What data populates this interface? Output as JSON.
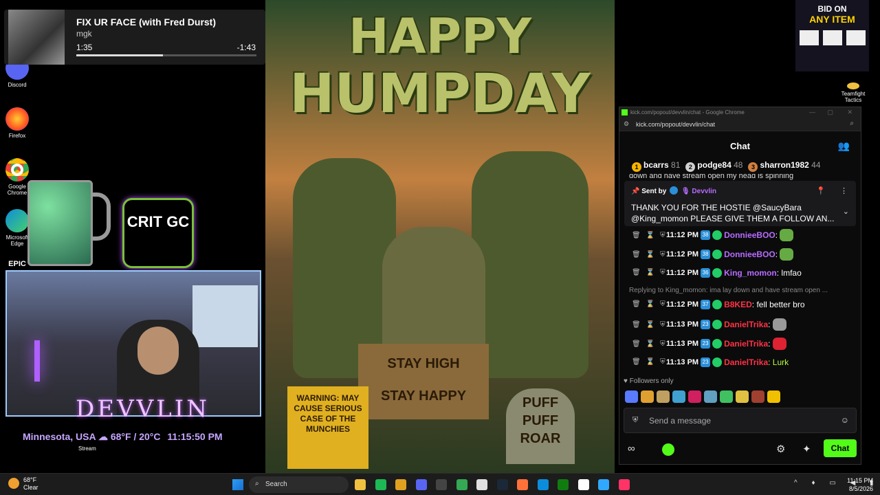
{
  "media": {
    "title": "FIX UR FACE (with Fred Durst)",
    "artist": "mgk",
    "elapsed": "1:35",
    "remaining": "-1:43",
    "progress": 0.48
  },
  "desktop_icons": [
    {
      "label": "Discord",
      "icon": "discord-icon",
      "color": "#5865f2"
    },
    {
      "label": "Firefox",
      "icon": "firefox-icon",
      "color": "#ff7139"
    },
    {
      "label": "Google Chrome",
      "icon": "chrome-icon",
      "color": "#34a853"
    },
    {
      "label": "Microsoft Edge",
      "icon": "edge-icon",
      "color": "#0c8ddb"
    },
    {
      "label": "EPIC",
      "icon": "epic-icon",
      "color": "#222222"
    }
  ],
  "overlay": {
    "crit_gc": "CRIT GC",
    "streamer_name": "DEVVLIN",
    "location": "Minnesota, USA",
    "weather": "68°F / 20°C",
    "clock": "11:15:50 PM",
    "stream_label": "Stream"
  },
  "poster": {
    "line1": "HAPPY",
    "line2": "HUMPDAY",
    "sign_center_1": "STAY HIGH",
    "sign_center_2": "STAY HAPPY",
    "sign_left": "WARNING: MAY CAUSE SERIOUS CASE OF THE MUNCHIES",
    "sign_right": "PUFF PUFF ROAR"
  },
  "bid": {
    "line1": "BID ON",
    "line2": "ANY ITEM"
  },
  "tft_label": "Teamfight Tactics",
  "chrome": {
    "window_title": "kick.com/popout/devvlin/chat - Google Chrome",
    "url": "kick.com/popout/devvlin/chat"
  },
  "chat": {
    "header": "Chat",
    "leaderboard": [
      {
        "rank": "1",
        "name": "bcarrs",
        "points": "81",
        "color": "#f5b400"
      },
      {
        "rank": "2",
        "name": "podge84",
        "points": "48",
        "color": "#d0d0d0"
      },
      {
        "rank": "3",
        "name": "sharron1982",
        "points": "44",
        "color": "#d08040"
      }
    ],
    "partial_line": "down and have stream open my head is spinning",
    "pinned": {
      "sent_by_label": "Sent by",
      "sender": "Devvlin",
      "message": "THANK YOU FOR THE HOSTIE @SaucyBara @King_momon PLEASE GIVE THEM A FOLLOW AN..."
    },
    "messages": [
      {
        "time": "11:12 PM",
        "sub": "38",
        "user": "DonnieeBOO",
        "color": "#b86cff",
        "text": ":",
        "emote": "#66aa44"
      },
      {
        "time": "11:12 PM",
        "sub": "38",
        "user": "DonnieeBOO",
        "color": "#b86cff",
        "text": ":",
        "emote": "#66aa44"
      },
      {
        "time": "11:12 PM",
        "sub": "36",
        "user": "King_momon",
        "color": "#b86cff",
        "text": ": lmfao",
        "emote": ""
      },
      {
        "reply": "Replying to King_momon: ima lay down and have stream open ..."
      },
      {
        "time": "11:12 PM",
        "sub": "37",
        "user": "B8KED",
        "color": "#ff3344",
        "text": ": fell better bro",
        "emote": ""
      },
      {
        "time": "11:13 PM",
        "sub": "23",
        "user": "DanielTrika",
        "color": "#ff3344",
        "text": ":",
        "emote": "#999999"
      },
      {
        "time": "11:13 PM",
        "sub": "23",
        "user": "DanielTrika",
        "color": "#ff3344",
        "text": ":",
        "emote": "#dd2233"
      },
      {
        "time": "11:13 PM",
        "sub": "23",
        "user": "DanielTrika",
        "color": "#ff3344",
        "text": ": Lurk",
        "emote": "",
        "text_color": "#b7ff3a"
      }
    ],
    "followers_only": "Followers only",
    "emote_colors": [
      "#5a7aff",
      "#e0a030",
      "#c0a060",
      "#40a0d0",
      "#d02060",
      "#60a0c0",
      "#40c060",
      "#e0c040",
      "#a04030",
      "#f0c000"
    ],
    "input_placeholder": "Send a message",
    "send_label": "Chat"
  },
  "taskbar": {
    "temp": "68°F",
    "condition": "Clear",
    "search_placeholder": "Search",
    "time": "11:15 PM",
    "date": "8/5/2026",
    "apps": [
      {
        "icon": "file-explorer-icon",
        "color": "#f0c040"
      },
      {
        "icon": "spotify-icon",
        "color": "#1db954"
      },
      {
        "icon": "folder-icon",
        "color": "#e0a020"
      },
      {
        "icon": "discord-icon",
        "color": "#5865f2"
      },
      {
        "icon": "obs-icon",
        "color": "#444444"
      },
      {
        "icon": "chrome-icon",
        "color": "#34a853"
      },
      {
        "icon": "calendar-icon",
        "color": "#e0e0e0"
      },
      {
        "icon": "steam-icon",
        "color": "#1b2838"
      },
      {
        "icon": "firefox-icon",
        "color": "#ff7139"
      },
      {
        "icon": "edge-icon",
        "color": "#0c8ddb"
      },
      {
        "icon": "xbox-icon",
        "color": "#107c10"
      },
      {
        "icon": "capcut-icon",
        "color": "#ffffff"
      },
      {
        "icon": "photoshop-icon",
        "color": "#31a8ff"
      },
      {
        "icon": "indesign-icon",
        "color": "#ff3366"
      }
    ]
  }
}
